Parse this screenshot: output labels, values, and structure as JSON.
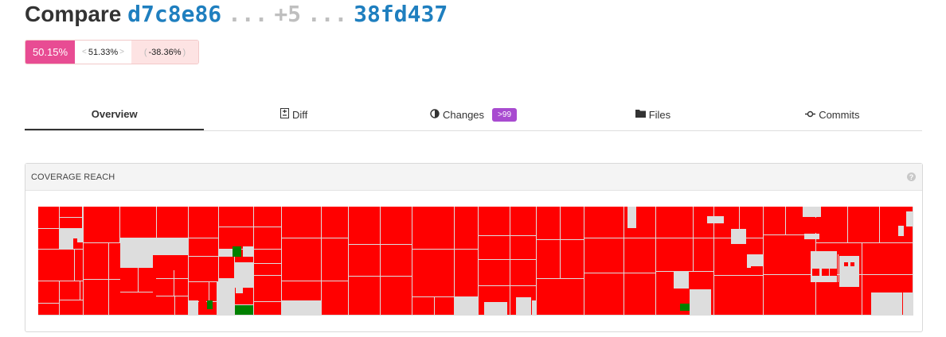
{
  "header": {
    "title_word": "Compare",
    "base_sha": "d7c8e86",
    "dots_left": "...",
    "between_count": "+5",
    "dots_right": "...",
    "head_sha": "38fd437"
  },
  "coverage": {
    "base_label": "50.15%",
    "head_value": "51.33%",
    "left_arrow": "<",
    "right_arrow": ">",
    "diff_value": "-38.36%",
    "diff_open": "(",
    "diff_close": ")"
  },
  "tabs": [
    {
      "label": "Overview",
      "icon": "",
      "active": true
    },
    {
      "label": "Diff",
      "icon": "diff-icon"
    },
    {
      "label": "Changes",
      "icon": "half-circle-icon",
      "badge": ">99"
    },
    {
      "label": "Files",
      "icon": "folder-icon"
    },
    {
      "label": "Commits",
      "icon": "commit-icon"
    }
  ],
  "panel": {
    "title": "COVERAGE REACH",
    "help_glyph": "?"
  },
  "treemap": {
    "colors": {
      "miss": "#ff0000",
      "hit": "#008000",
      "none": "#dddddd"
    }
  }
}
